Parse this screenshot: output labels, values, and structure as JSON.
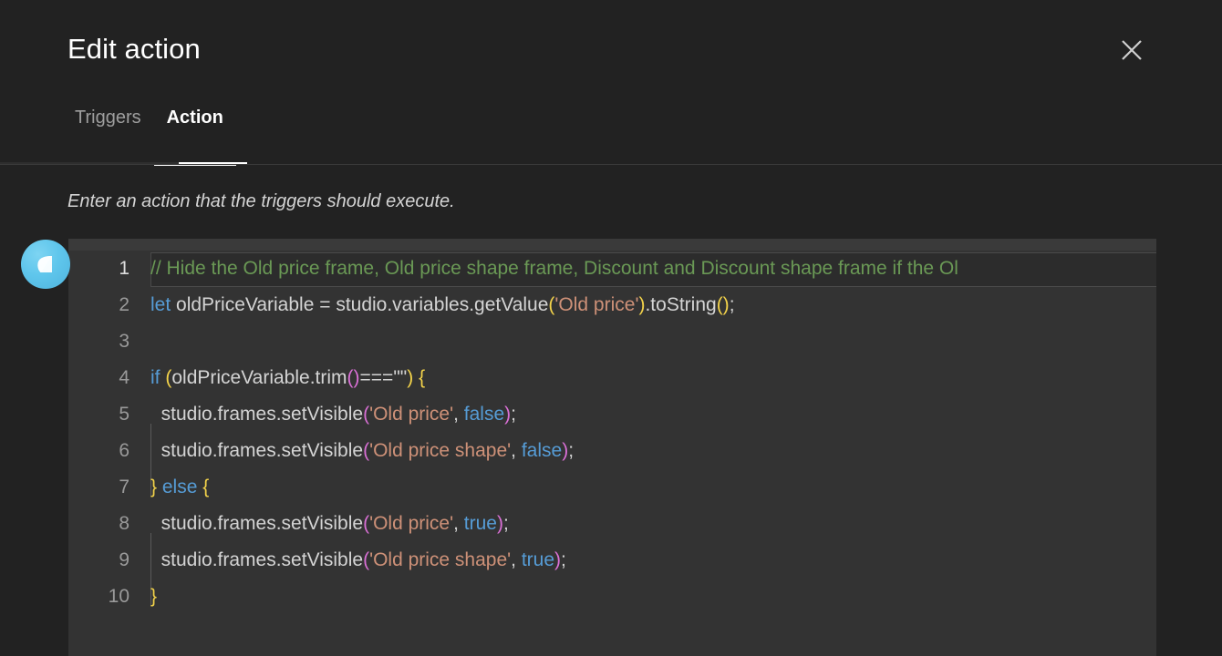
{
  "dialog": {
    "title": "Edit action",
    "close_icon": "close-icon"
  },
  "tabs": [
    {
      "label": "Triggers",
      "active": false
    },
    {
      "label": "Action",
      "active": true
    }
  ],
  "subtitle": "Enter an action that the triggers should execute.",
  "avatar": {
    "icon": "leaf-icon"
  },
  "editor": {
    "language": "javascript",
    "visible_lines": 10,
    "current_line": 1,
    "lines": [
      {
        "number": "1",
        "text": "// Hide the Old price frame, Old price shape frame, Discount and Discount shape frame if the Ol"
      },
      {
        "number": "2",
        "text": "let oldPriceVariable = studio.variables.getValue('Old price').toString();"
      },
      {
        "number": "3",
        "text": ""
      },
      {
        "number": "4",
        "text": "if (oldPriceVariable.trim()===\"\") {"
      },
      {
        "number": "5",
        "text": "  studio.frames.setVisible('Old price', false);"
      },
      {
        "number": "6",
        "text": "  studio.frames.setVisible('Old price shape', false);"
      },
      {
        "number": "7",
        "text": "} else {"
      },
      {
        "number": "8",
        "text": "  studio.frames.setVisible('Old price', true);"
      },
      {
        "number": "9",
        "text": "  studio.frames.setVisible('Old price shape', true);"
      },
      {
        "number": "10",
        "text": "}"
      }
    ]
  },
  "colors": {
    "page_background": "#222222",
    "editor_background": "#333333",
    "comment": "#6a9955",
    "keyword": "#569cd6",
    "string": "#ce9178",
    "plain_text": "#d4d4d4",
    "bracket_yellow": "#f3d34a",
    "bracket_magenta": "#da70d6",
    "accent_underline": "#ffffff",
    "avatar_blue": "#5fc6ec"
  }
}
